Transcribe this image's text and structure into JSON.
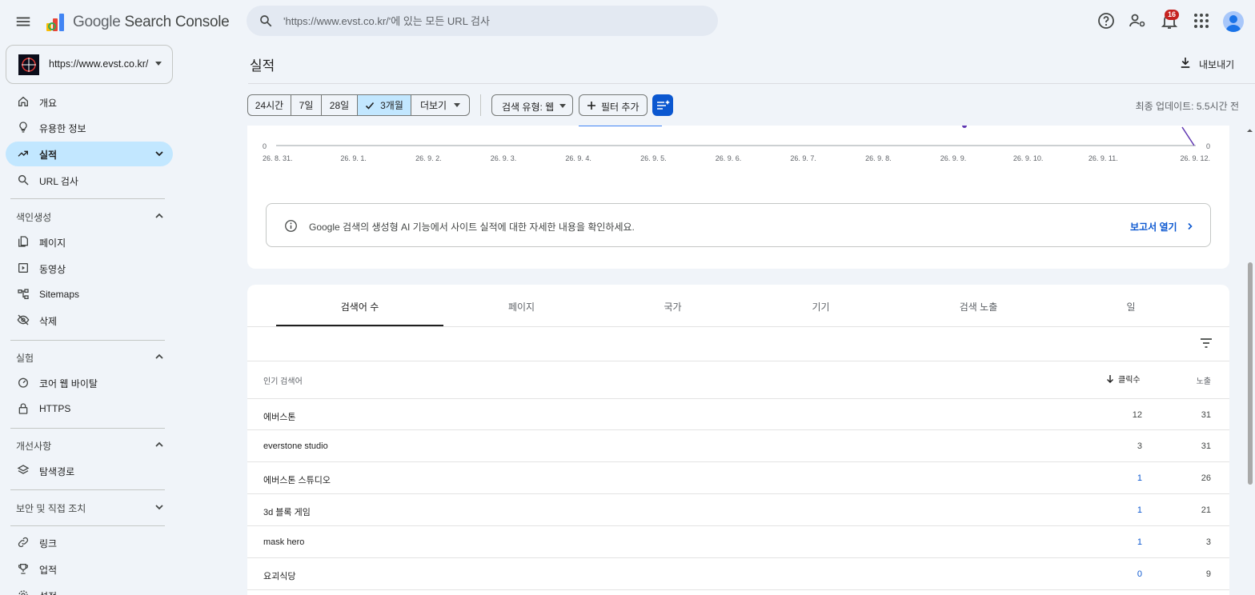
{
  "header": {
    "app_title_brand": "Google",
    "app_title_product": "Search Console",
    "search_placeholder": "'https://www.evst.co.kr/'에 있는 모든 URL 검사",
    "notification_count": "16"
  },
  "sidebar": {
    "property_url": "https://www.evst.co.kr/",
    "items_top": [
      {
        "label": "개요",
        "icon": "home-icon"
      },
      {
        "label": "유용한 정보",
        "icon": "lightbulb-icon"
      },
      {
        "label": "실적",
        "icon": "trending-up-icon"
      },
      {
        "label": "URL 검사",
        "icon": "search-icon"
      }
    ],
    "sections": [
      {
        "label": "색인생성",
        "items": [
          {
            "label": "페이지",
            "icon": "pages-icon"
          },
          {
            "label": "동영상",
            "icon": "video-icon"
          },
          {
            "label": "Sitemaps",
            "icon": "sitemap-icon"
          },
          {
            "label": "삭제",
            "icon": "visibility-off-icon"
          }
        ]
      },
      {
        "label": "실험",
        "items": [
          {
            "label": "코어 웹 바이탈",
            "icon": "speed-icon"
          },
          {
            "label": "HTTPS",
            "icon": "lock-icon"
          }
        ]
      },
      {
        "label": "개선사항",
        "items": [
          {
            "label": "탐색경로",
            "icon": "layers-icon"
          }
        ]
      },
      {
        "label": "보안 및 직접 조치",
        "items": []
      }
    ],
    "items_bottom": [
      {
        "label": "링크",
        "icon": "link-icon"
      },
      {
        "label": "업적",
        "icon": "trophy-icon"
      },
      {
        "label": "설정",
        "icon": "gear-icon"
      }
    ]
  },
  "page": {
    "title": "실적",
    "export_label": "내보내기",
    "date_ranges": [
      "24시간",
      "7일",
      "28일",
      "3개월"
    ],
    "more_label": "더보기",
    "search_type_label": "검색 유형: 웹",
    "add_filter_label": "필터 추가",
    "last_updated": "최종 업데이트: 5.5시간 전"
  },
  "chart_data": {
    "type": "line",
    "x": [
      "26. 8. 31.",
      "26. 9. 1.",
      "26. 9. 2.",
      "26. 9. 3.",
      "26. 9. 4.",
      "26. 9. 5.",
      "26. 9. 6.",
      "26. 9. 7.",
      "26. 9. 8.",
      "26. 9. 9.",
      "26. 9. 10.",
      "26. 9. 11.",
      "26. 9. 12."
    ],
    "y_left_min_label": "0",
    "y_right_min_label": "0"
  },
  "info_banner": {
    "text": "Google 검색의 생성형 AI 기능에서 사이트 실적에 대한 자세한 내용을 확인하세요.",
    "link_label": "보고서 열기"
  },
  "table": {
    "tabs": [
      "검색어 수",
      "페이지",
      "국가",
      "기기",
      "검색 노출",
      "일"
    ],
    "col_query": "인기 검색어",
    "col_clicks": "클릭수",
    "col_impressions": "노출",
    "rows": [
      {
        "query": "에버스톤",
        "clicks": "12",
        "impressions": "31"
      },
      {
        "query": "everstone studio",
        "clicks": "3",
        "impressions": "31"
      },
      {
        "query": "에버스톤 스튜디오",
        "clicks": "1",
        "impressions": "26"
      },
      {
        "query": "3d 블록 게임",
        "clicks": "1",
        "impressions": "21"
      },
      {
        "query": "mask hero",
        "clicks": "1",
        "impressions": "3"
      },
      {
        "query": "요괴식당",
        "clicks": "0",
        "impressions": "9"
      }
    ]
  },
  "colors": {
    "accent": "#0b57d0",
    "active_nav": "#c2e7ff",
    "background": "#f0f4f9"
  }
}
